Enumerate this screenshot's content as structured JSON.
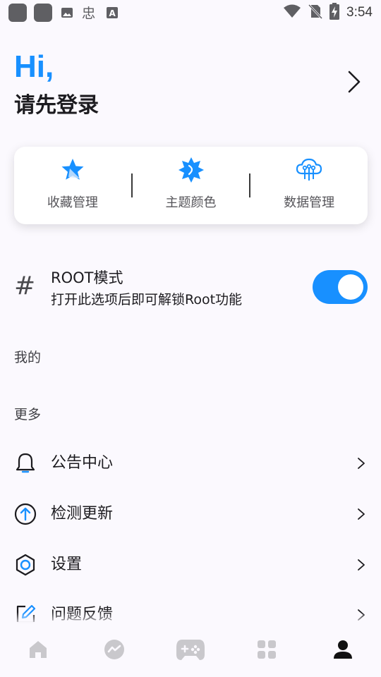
{
  "status_bar": {
    "time": "3:54",
    "left_icons": [
      "app-icon",
      "app-icon",
      "image-icon",
      "wechat-icon",
      "font-icon"
    ],
    "right_icons": [
      "wifi-icon",
      "no-sim-icon",
      "battery-charging-icon"
    ]
  },
  "header": {
    "greeting": "Hi,",
    "login_prompt": "请先登录"
  },
  "quick_actions": [
    {
      "label": "收藏管理",
      "icon": "star-icon"
    },
    {
      "label": "主题颜色",
      "icon": "theme-icon"
    },
    {
      "label": "数据管理",
      "icon": "cloud-data-icon"
    }
  ],
  "root_mode": {
    "title": "ROOT模式",
    "subtitle": "打开此选项后即可解锁Root功能",
    "enabled": true
  },
  "sections": {
    "mine": "我的",
    "more": "更多"
  },
  "menu": [
    {
      "label": "公告中心",
      "icon": "bell-icon"
    },
    {
      "label": "检测更新",
      "icon": "arrow-up-circle-icon"
    },
    {
      "label": "设置",
      "icon": "hexagon-settings-icon"
    },
    {
      "label": "问题反馈",
      "icon": "edit-feedback-icon"
    }
  ],
  "bottom_nav": [
    {
      "name": "home",
      "icon": "home-icon",
      "active": false
    },
    {
      "name": "messages",
      "icon": "chat-icon",
      "active": false
    },
    {
      "name": "games",
      "icon": "gamepad-icon",
      "active": false
    },
    {
      "name": "apps",
      "icon": "grid-icon",
      "active": false
    },
    {
      "name": "profile",
      "icon": "person-icon",
      "active": true
    }
  ],
  "colors": {
    "accent": "#1890ff",
    "background": "#fbf9fe",
    "nav_inactive": "#c9c8cc",
    "nav_active": "#111111"
  }
}
